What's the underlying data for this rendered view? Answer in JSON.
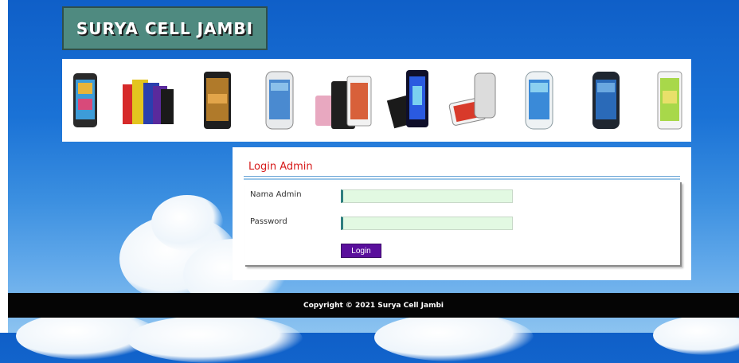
{
  "site": {
    "title": "SURYA CELL JAMBI"
  },
  "banner": {
    "phones": [
      "phone-1",
      "phone-2",
      "phone-3",
      "phone-4",
      "phone-5",
      "phone-6",
      "phone-7",
      "phone-8",
      "phone-9",
      "phone-10"
    ]
  },
  "login": {
    "title": "Login Admin",
    "username_label": "Nama Admin",
    "username_value": "",
    "password_label": "Password",
    "password_value": "",
    "button_label": "Login"
  },
  "footer": {
    "copyright": "Copyright © 2021 Surya Cell Jambi"
  },
  "colors": {
    "header_bg": "#4f8a80",
    "title_red": "#d61a1a",
    "input_bg": "#e2f9e2",
    "button_bg": "#5a0f9c",
    "footer_bg": "#050505"
  }
}
